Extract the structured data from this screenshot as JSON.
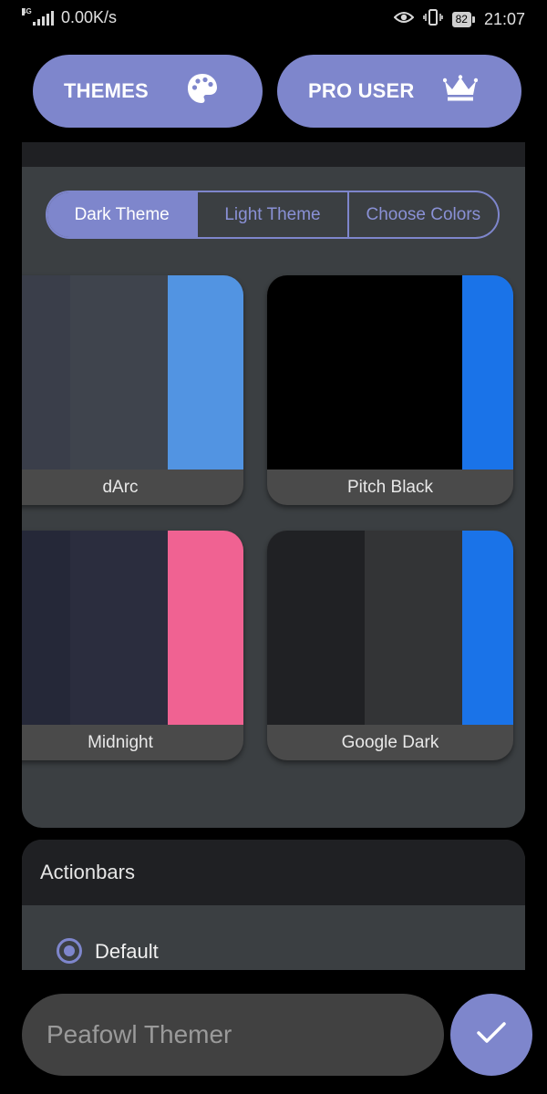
{
  "status_bar": {
    "network_type": "4G",
    "data_speed": "0.00K/s",
    "battery": "82",
    "time": "21:07"
  },
  "header": {
    "themes_label": "THEMES",
    "pro_label": "PRO USER",
    "accent_color": "#7e86cc"
  },
  "theme_section": {
    "tabs": [
      "Dark Theme",
      "Light Theme",
      "Choose Colors"
    ],
    "selected_tab": "Dark Theme",
    "themes": [
      {
        "name": "dArc",
        "colors": [
          "#3a3e4a",
          "#3f444d",
          "#5294e2"
        ]
      },
      {
        "name": "Pitch Black",
        "colors": [
          "#000000",
          "#000000",
          "#1a73e8"
        ]
      },
      {
        "name": "Midnight",
        "colors": [
          "#252838",
          "#2b2d3e",
          "#f06292"
        ]
      },
      {
        "name": "Google Dark",
        "colors": [
          "#202124",
          "#333436",
          "#1a73e8"
        ]
      }
    ]
  },
  "actionbars": {
    "title": "Actionbars",
    "selected_option": "Default"
  },
  "bottom_bar": {
    "app_name": "Peafowl Themer",
    "confirm_icon": "check-icon"
  }
}
